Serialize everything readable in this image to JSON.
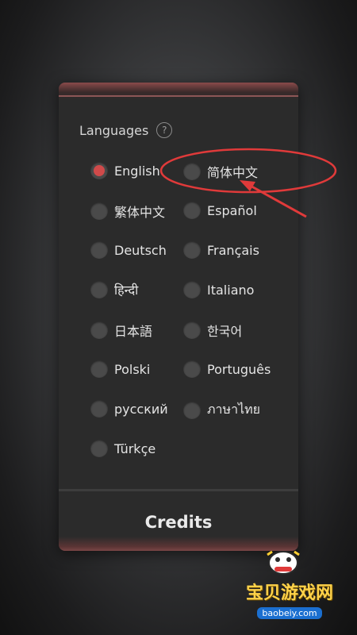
{
  "dialog": {
    "header": "Languages",
    "help_symbol": "?",
    "credits_label": "Credits"
  },
  "languages": [
    {
      "label": "English",
      "checked": true
    },
    {
      "label": "简体中文",
      "checked": false
    },
    {
      "label": "繁体中文",
      "checked": false
    },
    {
      "label": "Español",
      "checked": false
    },
    {
      "label": "Deutsch",
      "checked": false
    },
    {
      "label": "Français",
      "checked": false
    },
    {
      "label": "हिन्दी",
      "checked": false
    },
    {
      "label": "Italiano",
      "checked": false
    },
    {
      "label": "日本語",
      "checked": false
    },
    {
      "label": "한국어",
      "checked": false
    },
    {
      "label": "Polski",
      "checked": false
    },
    {
      "label": "Português",
      "checked": false
    },
    {
      "label": "русский",
      "checked": false
    },
    {
      "label": "ภาษาไทย",
      "checked": false
    },
    {
      "label": "Türkçe",
      "checked": false
    }
  ],
  "watermark": {
    "title": "宝贝游戏网",
    "url": "baobeiy.com"
  },
  "colors": {
    "accent_red": "#d04a4a",
    "annotation_red": "#e03a3a",
    "panel_bg": "#2b2b2b"
  }
}
